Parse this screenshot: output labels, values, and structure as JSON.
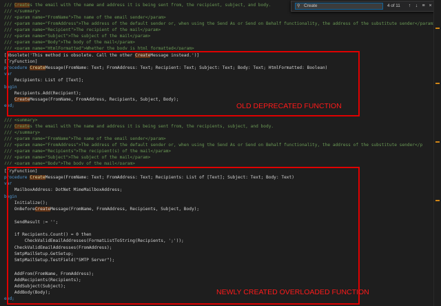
{
  "find": {
    "query": "Create",
    "count": "4 of 11",
    "prev_icon": "arrow-up-icon",
    "next_icon": "arrow-down-icon",
    "menu_icon": "menu-icon",
    "close_icon": "close-icon",
    "search_icon": "search-icon"
  },
  "annotations": {
    "old_label": "OLD DEPRECATED FUNCTION",
    "new_label": "NEWLY CREATED OVERLOADED FUNCTION",
    "color": "#e00000"
  },
  "code": {
    "l0a": "/// ",
    "l0b": "Create",
    "l0c": "s the email with the name and address it is being sent from, the recipient, subject, and body.",
    "l1": "/// </summary>",
    "l2": "/// <param name=\"FromName\">The name of the email sender</param>",
    "l3": "/// <param name=\"FromAddress\">The address of the default sender or, when using the Send As or Send on Behalf functionality, the address of the substitute sender</param>",
    "l4": "/// <param name=\"Recipient\">The recipient of the mail</param>",
    "l5": "/// <param name=\"Subject\">The subject of the mail</param>",
    "l6": "/// <param name=\"Body\">The body of the mail</param>",
    "l7": "/// <param name=\"HtmlFormatted\">Whether the body is html formatted</param>",
    "o1a": "[Obsolete('This method is obsolete. Call the other ",
    "o1b": "Create",
    "o1c": "Message instead.')]",
    "o2": "[TryFunction]",
    "o3a": "procedure ",
    "o3b": "Create",
    "o3c": "Message(FromName: Text; FromAddress: Text; Recipient: Text; Subject: Text; Body: Text; HtmlFormatted: Boolean)",
    "o4": "var",
    "o5": "    Recipients: List of [Text];",
    "o6": "begin",
    "o7": "    Recipients.Add(Recipient);",
    "o8a": "    ",
    "o8b": "Create",
    "o8c": "Message(FromName, FromAddress, Recipients, Subject, Body);",
    "o9": "end;",
    "m1": "/// <summary>",
    "m2a": "/// ",
    "m2b": "Create",
    "m2c": "s the email with the name and address it is being sent from, the recipients, subject, and body.",
    "m3": "/// </summary>",
    "m4": "/// <param name=\"FromName\">The name of the email sender</param>",
    "m5": "/// <param name=\"FromAddress\">The address of the default sender or, when using the Send As or Send on Behalf functionality, the address of the substitute sender</p",
    "m6": "/// <param name=\"Recipients\">The recipient(s) of the mail</param>",
    "m7": "/// <param name=\"Subject\">The subject of the mail</param>",
    "m8": "/// <param name=\"Body\">The body of the mail</param>",
    "n1": "[TryFunction]",
    "n2a": "procedure ",
    "n2b": "Create",
    "n2c": "Message(FromName: Text; FromAddress: Text; Recipients: List of [Text]; Subject: Text; Body: Text)",
    "n3": "var",
    "n4": "    MailboxAddress: DotNet MimeMailboxAddress;",
    "n5": "begin",
    "n6": "    Initialize();",
    "n7a": "    OnBefore",
    "n7b": "Create",
    "n7c": "Message(FromName, FromAddress, Recipients, Subject, Body);",
    "n8": "    SendResult := '';",
    "n9": "    if Recipients.Count() = 0 then",
    "n10": "        CheckValidEmailAddresses(FormatListToString(Recipients, ';'));",
    "n11": "    CheckValidEmailAddresses(FromAddress);",
    "n12": "    SmtpMailSetup.GetSetup;",
    "n13": "    SmtpMailSetup.TestField(\"SMTP Server\");",
    "n14": "    AddFrom(FromName, FromAddress);",
    "n15": "    AddRecipients(Recipients);",
    "n16": "    AddSubject(Subject);",
    "n17": "    AddBody(Body);",
    "n18": "end;"
  }
}
